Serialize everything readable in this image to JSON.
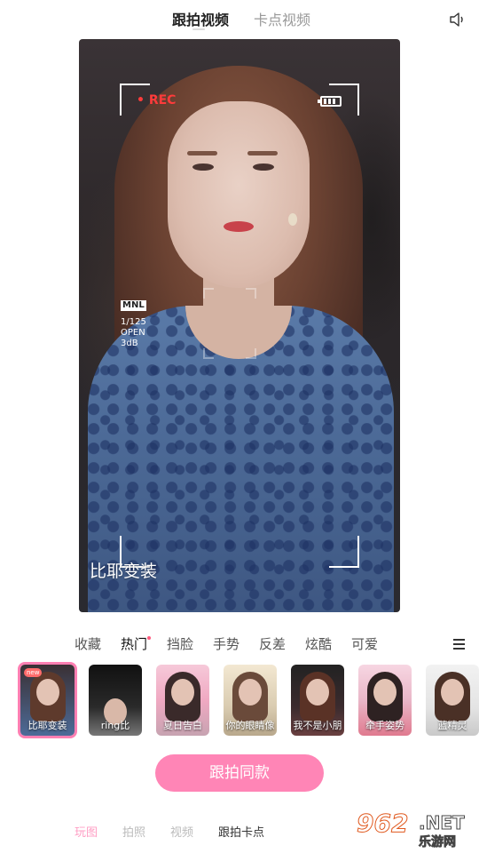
{
  "top_tabs": {
    "active": "跟拍视频",
    "inactive": "卡点视频"
  },
  "icons": {
    "speaker": "speaker-icon",
    "menu": "hamburger-menu-icon",
    "battery": "battery-icon"
  },
  "preview": {
    "rec": "• REC",
    "mode_badge": "MNL",
    "shutter": "1/125",
    "aperture": "OPEN",
    "gain": "3dB",
    "effect_name": "比耶变装"
  },
  "categories": [
    "收藏",
    "热门",
    "挡脸",
    "手势",
    "反差",
    "炫酷",
    "可爱"
  ],
  "active_category": "热门",
  "thumbnails": [
    {
      "label": "比耶变装",
      "badge": "new",
      "selected": true
    },
    {
      "label": "ring比"
    },
    {
      "label": "夏日告白"
    },
    {
      "label": "你的眼睛像"
    },
    {
      "label": "我不是小朋"
    },
    {
      "label": "牵手姿势"
    },
    {
      "label": "蓝精灵"
    }
  ],
  "cta_label": "跟拍同款",
  "bottom_tabs": [
    "玩图",
    "拍照",
    "视频",
    "跟拍卡点"
  ],
  "watermark": {
    "num": "962",
    "net": ".NET",
    "cn": "乐游网"
  },
  "colors": {
    "accent": "#ff85b6",
    "rec": "#ff3b3b",
    "selected_border": "#ff7fb2"
  }
}
